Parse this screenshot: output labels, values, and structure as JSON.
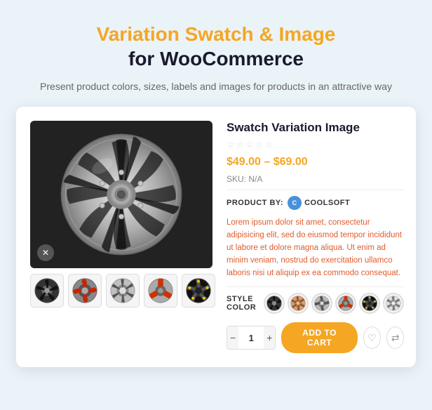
{
  "header": {
    "title_line1": "Variation Swatch & Image",
    "title_line2": "for WooCommerce",
    "subtitle": "Present product colors, sizes, labels and images for products\nin an attractive way"
  },
  "product": {
    "title": "Swatch Variation Image",
    "price": "$49.00 – $69.00",
    "sku_label": "SKU:",
    "sku_value": "N/A",
    "product_by_label": "PRODUCT BY:",
    "brand": "COOLSOFT",
    "description": "Lorem ipsum dolor sit amet, consectetur adipisicing elit, sed do eiusmod tempor incididunt ut labore et dolore magna aliqua. Ut enim ad minim veniam, nostrud do exercitation ullamco laboris nisi ut aliquip ex ea commodo consequat.",
    "style_color_label": "STYLE COLOR",
    "quantity": "1",
    "add_to_cart_label": "Add To Cart",
    "stars": [
      "★",
      "★",
      "★",
      "★",
      "★"
    ]
  },
  "icons": {
    "close": "✕",
    "minus": "−",
    "plus": "+",
    "heart": "♡",
    "compare": "⇄"
  },
  "colors": {
    "orange": "#f5a623",
    "dark": "#1a1a2e",
    "body_bg": "#eaf3f8"
  }
}
